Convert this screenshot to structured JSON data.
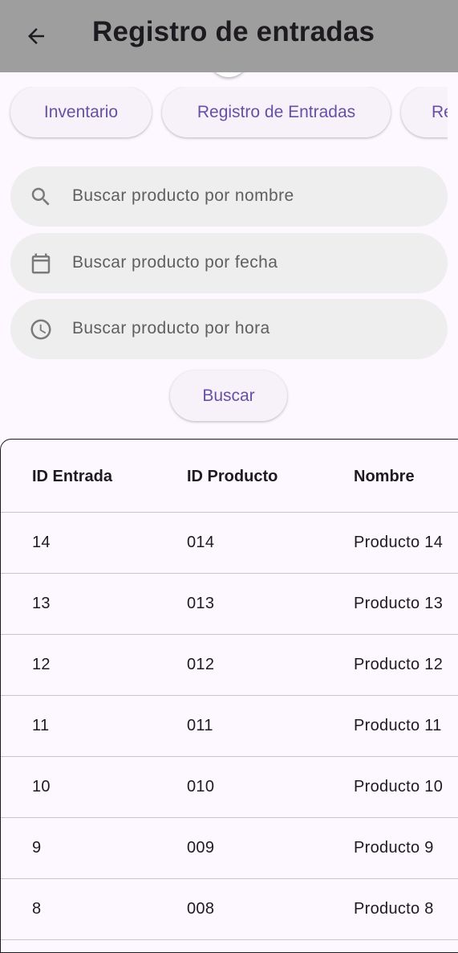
{
  "appbar": {
    "title": "Registro de entradas",
    "back_icon": "arrow-left-icon"
  },
  "tabs": [
    {
      "label": "Inventario"
    },
    {
      "label": "Registro de Entradas"
    },
    {
      "label": "Re"
    }
  ],
  "search": {
    "name_placeholder": "Buscar producto por nombre",
    "date_placeholder": "Buscar producto por fecha",
    "time_placeholder": "Buscar producto por hora",
    "button_label": "Buscar",
    "icons": [
      "search-icon",
      "calendar-icon",
      "clock-icon"
    ]
  },
  "colors": {
    "appbar": "#9e9e9e",
    "accent": "#6750a4",
    "field_bg": "#eeeeee",
    "page_bg": "#fdf7ff"
  },
  "table": {
    "headers": [
      "ID Entrada",
      "ID Producto",
      "Nombre"
    ],
    "rows": [
      [
        "14",
        "014",
        "Producto 14"
      ],
      [
        "13",
        "013",
        "Producto 13"
      ],
      [
        "12",
        "012",
        "Producto 12"
      ],
      [
        "11",
        "011",
        "Producto 11"
      ],
      [
        "10",
        "010",
        "Producto 10"
      ],
      [
        "9",
        "009",
        "Producto 9"
      ],
      [
        "8",
        "008",
        "Producto 8"
      ]
    ]
  }
}
